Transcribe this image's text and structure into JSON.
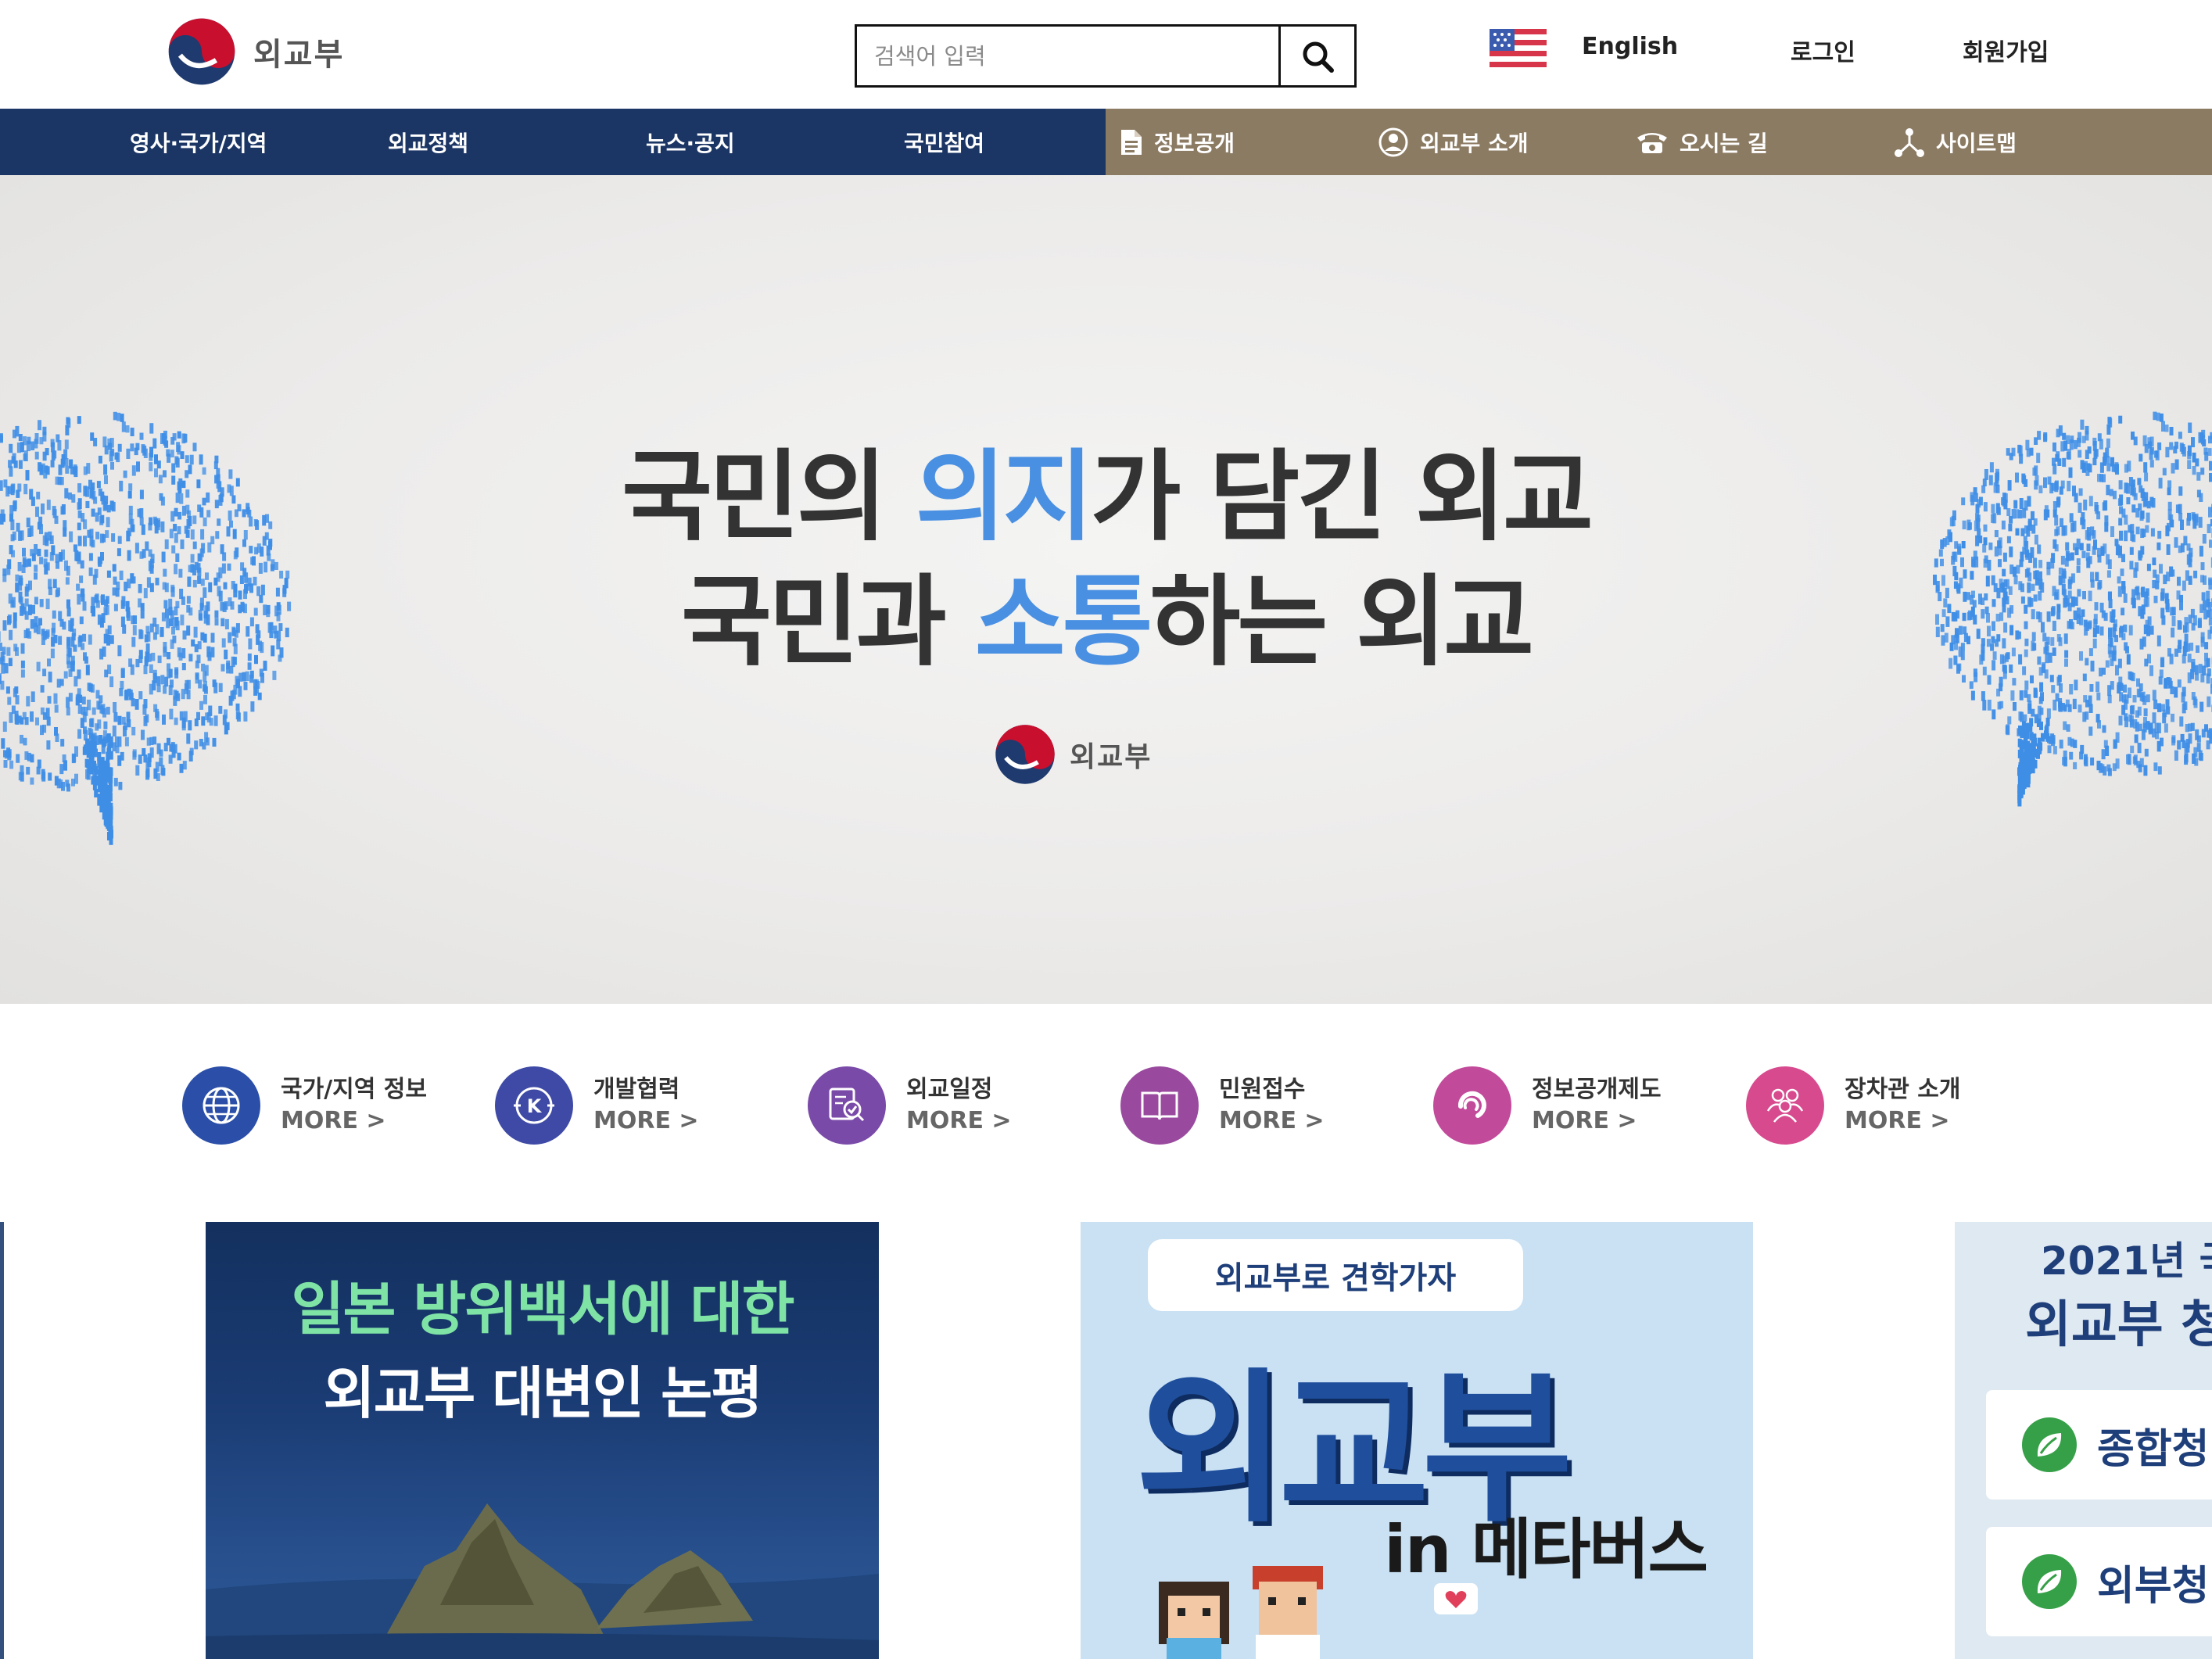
{
  "header": {
    "logo_text": "외교부",
    "search_placeholder": "검색어 입력",
    "links": {
      "english": "English",
      "login": "로그인",
      "signup": "회원가입"
    }
  },
  "nav": {
    "main": [
      "영사·국가/지역",
      "외교정책",
      "뉴스·공지",
      "국민참여"
    ],
    "util": [
      "정보공개",
      "외교부 소개",
      "오시는 길",
      "사이트맵"
    ]
  },
  "hero": {
    "line1_a": "국민의 ",
    "line1_hl": "의지",
    "line1_b": "가 담긴 외교",
    "line2_a": "국민과 ",
    "line2_hl": "소통",
    "line2_b": "하는 외교",
    "logo_text": "외교부"
  },
  "quick_links": [
    {
      "title": "국가/지역 정보",
      "more": "MORE >",
      "icon": "globe-icon",
      "color": "#2b4fa8"
    },
    {
      "title": "개발협력",
      "more": "MORE >",
      "icon": "k-coin-icon",
      "color": "#3e4aa5"
    },
    {
      "title": "외교일정",
      "more": "MORE >",
      "icon": "schedule-check-icon",
      "color": "#7a4aa8"
    },
    {
      "title": "민원접수",
      "more": "MORE >",
      "icon": "book-icon",
      "color": "#9a4a9e"
    },
    {
      "title": "정보공개제도",
      "more": "MORE >",
      "icon": "info-swirl-icon",
      "color": "#c24a9a"
    },
    {
      "title": "장차관 소개",
      "more": "MORE >",
      "icon": "people-icon",
      "color": "#d74b8e"
    }
  ],
  "banners": {
    "b1": {
      "line1": "일본 방위백서에 대한",
      "line2": "외교부 대변인 논평"
    },
    "b2": {
      "pill": "외교부로 견학가자",
      "big": "외교부",
      "meta": "in 메타버스"
    },
    "b3": {
      "line1": "2021년 국",
      "line2": "외교부 청",
      "card1": "종합청",
      "card2": "외부청"
    }
  }
}
